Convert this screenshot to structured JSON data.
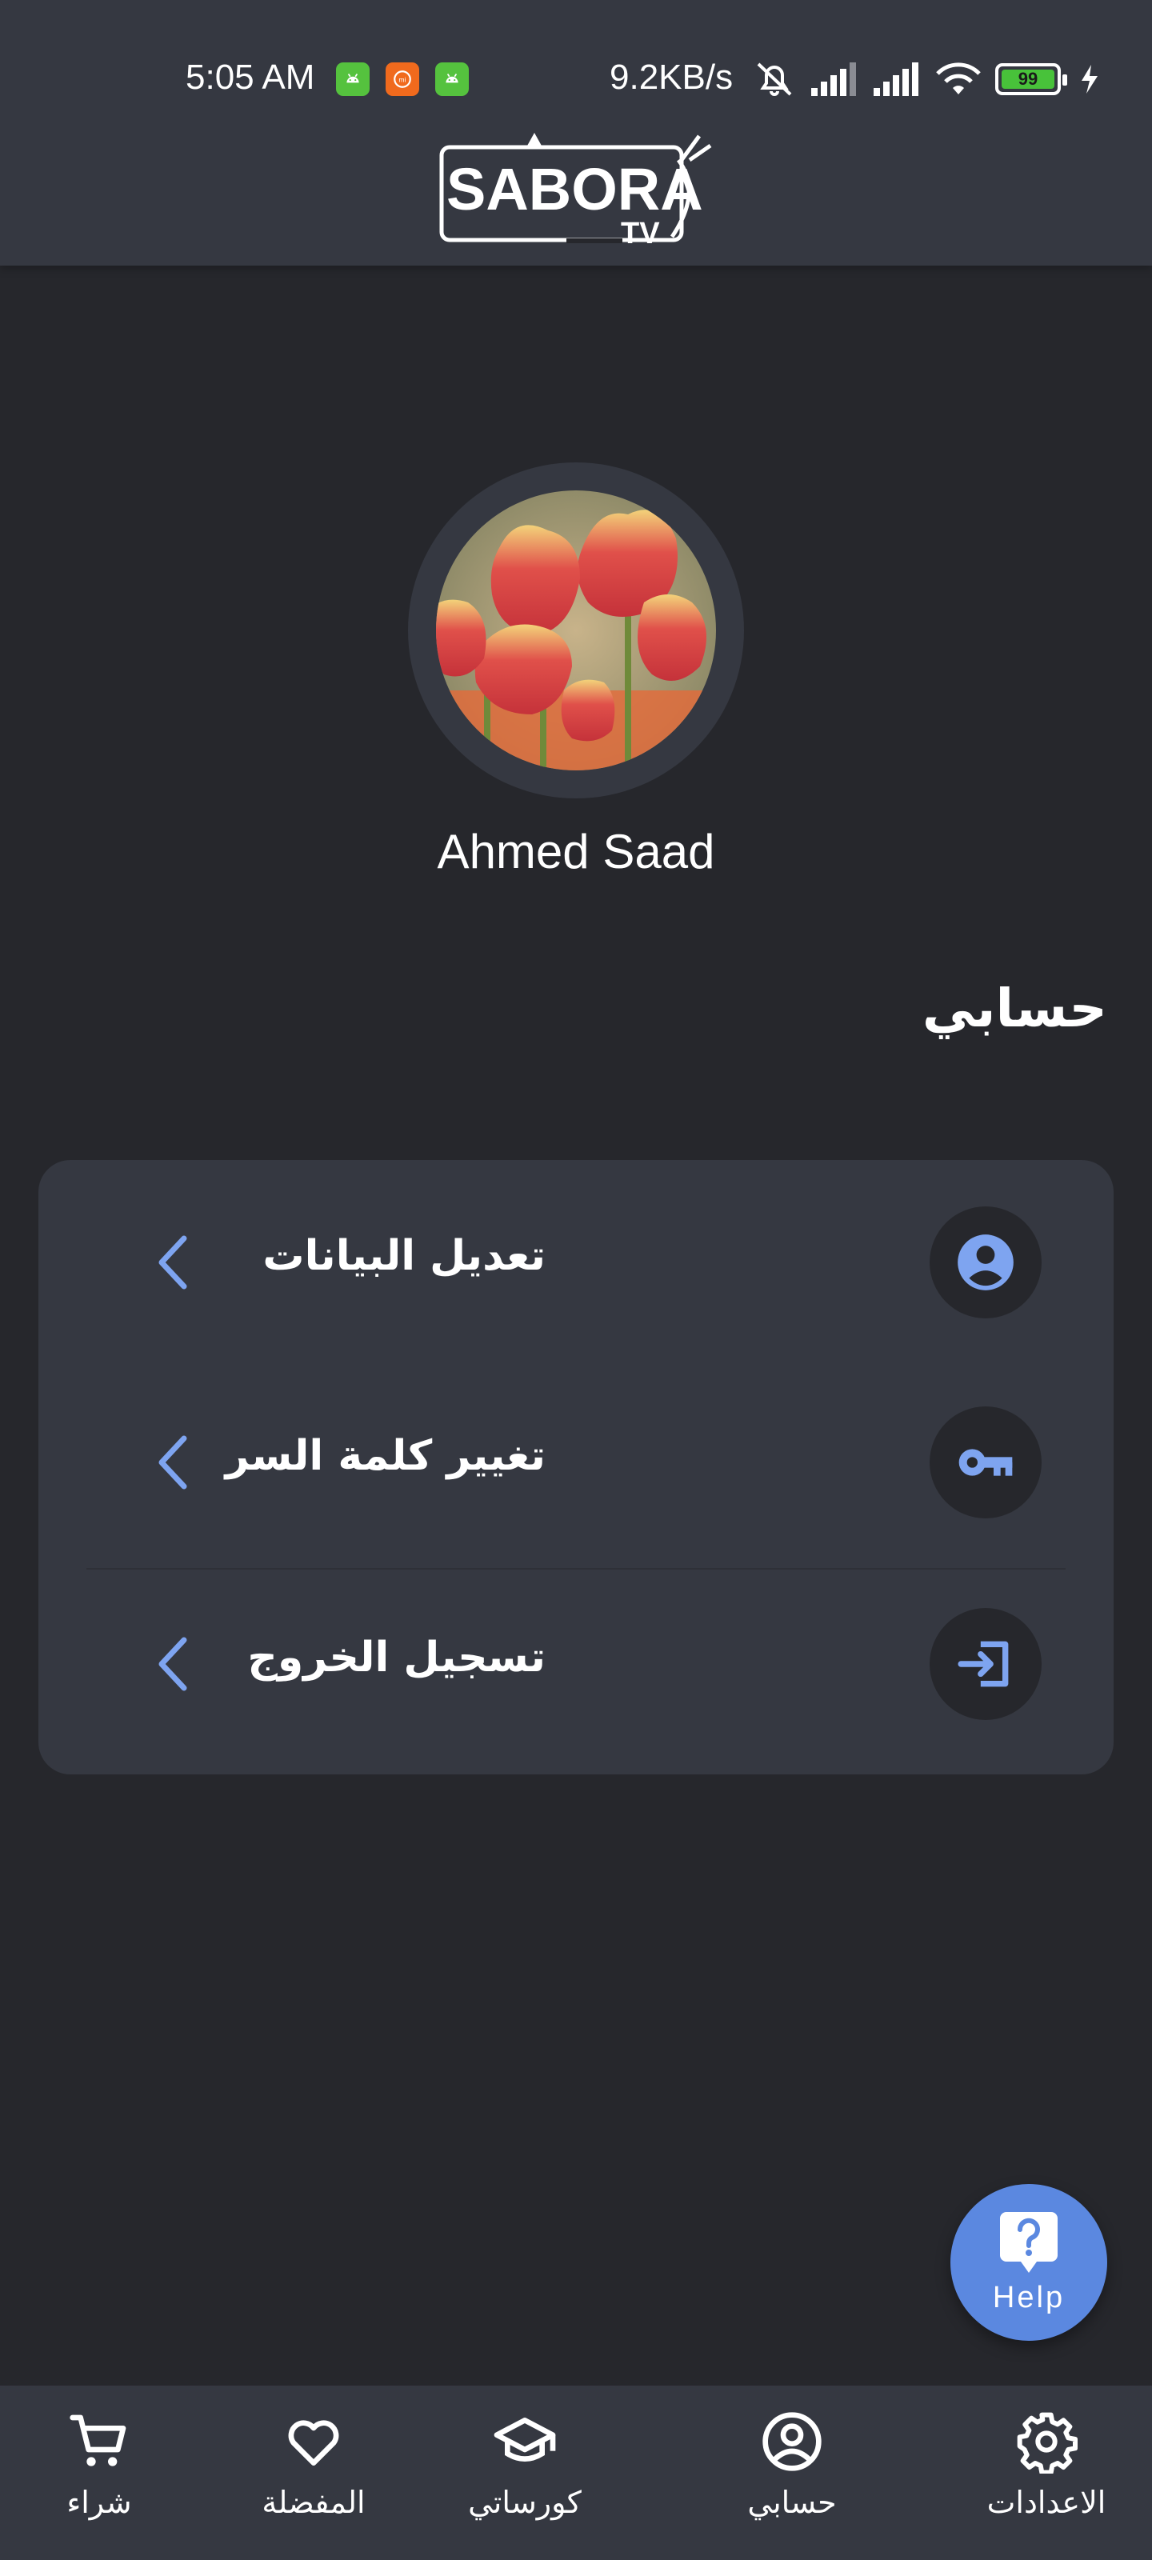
{
  "status_bar": {
    "time": "5:05 AM",
    "net_speed": "9.2KB/s",
    "battery": "99",
    "notification_icons": [
      "android-icon",
      "mi-icon",
      "android-icon"
    ]
  },
  "header": {
    "logo_text": "SABORA",
    "logo_sub": "TV"
  },
  "profile": {
    "name": "Ahmed Saad"
  },
  "section_title": "حسابي",
  "menu": [
    {
      "label": "تعديل البيانات",
      "icon": "account-circle-icon"
    },
    {
      "label": "تغيير كلمة السر",
      "icon": "key-icon"
    },
    {
      "label": "تسجيل الخروج",
      "icon": "logout-icon"
    }
  ],
  "help": {
    "label": "Help",
    "icon": "help-icon"
  },
  "bottom_nav": [
    {
      "label": "شراء",
      "icon": "cart-icon"
    },
    {
      "label": "المفضلة",
      "icon": "heart-icon"
    },
    {
      "label": "كورساتي",
      "icon": "graduation-cap-icon"
    },
    {
      "label": "حسابي",
      "icon": "account-icon"
    },
    {
      "label": "الاعدادات",
      "icon": "gear-icon"
    }
  ],
  "colors": {
    "background": "#26272c",
    "surface": "#353841",
    "accent": "#5b88e0",
    "icon_accent": "#7ea4f0"
  }
}
